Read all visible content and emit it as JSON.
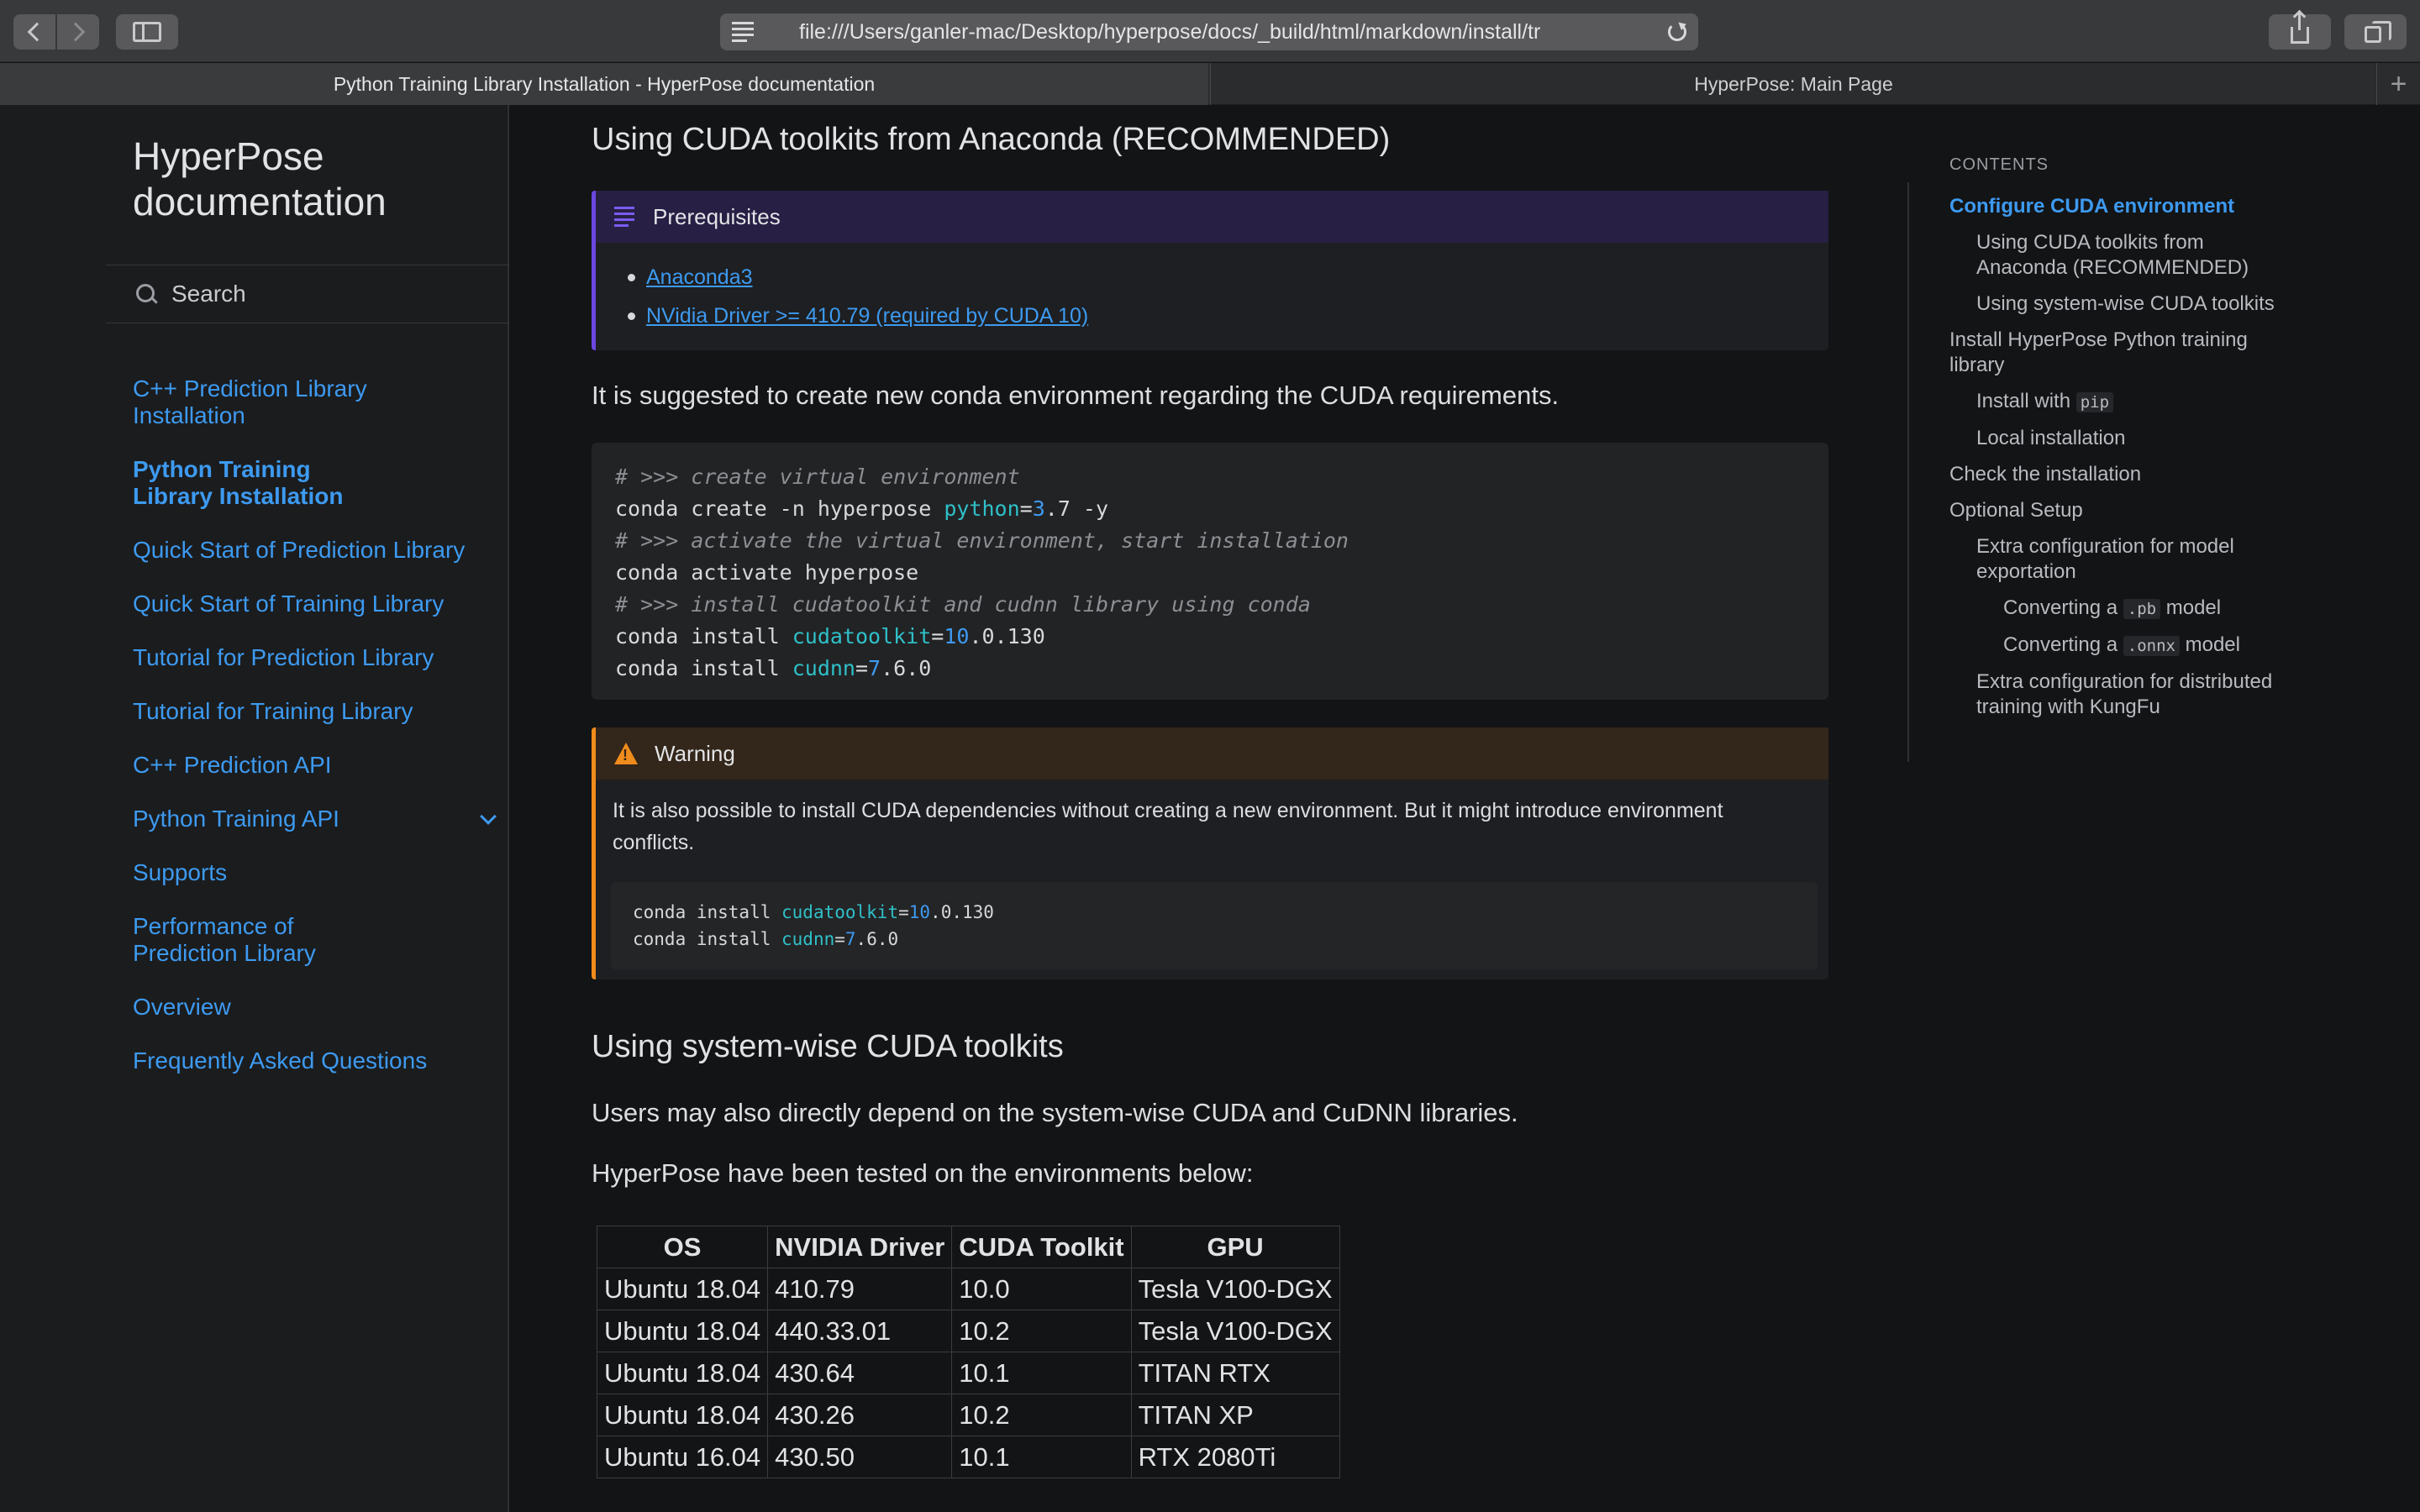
{
  "browser": {
    "url": "file:///Users/ganler-mac/Desktop/hyperpose/docs/_build/html/markdown/install/tr",
    "tabs": [
      {
        "title": "Python Training Library Installation - HyperPose documentation"
      },
      {
        "title": "HyperPose: Main Page"
      }
    ],
    "new_tab": "+"
  },
  "sidebar": {
    "brand": "HyperPose documentation",
    "search_placeholder": "Search",
    "nav": [
      {
        "label": "C++ Prediction Library Installation"
      },
      {
        "label": "Python Training Library Installation"
      },
      {
        "label": "Quick Start of Prediction Library"
      },
      {
        "label": "Quick Start of Training Library"
      },
      {
        "label": "Tutorial for Prediction Library"
      },
      {
        "label": "Tutorial for Training Library"
      },
      {
        "label": "C++ Prediction API"
      },
      {
        "label": "Python Training API"
      },
      {
        "label": "Supports"
      },
      {
        "label": "Performance of Prediction Library"
      },
      {
        "label": "Overview"
      },
      {
        "label": "Frequently Asked Questions"
      }
    ]
  },
  "main": {
    "heading_conda": "Using CUDA toolkits from Anaconda (RECOMMENDED)",
    "prereq": {
      "title": "Prerequisites",
      "items": [
        "Anaconda3",
        "NVidia Driver >= 410.79 (required by CUDA 10)"
      ]
    },
    "suggest_text": "It is suggested to create new conda environment regarding the CUDA requirements.",
    "code_lines": {
      "c1": "# >>> create virtual environment",
      "l2a": "conda create -n hyperpose ",
      "l2kw": "python",
      "l2eq": "=",
      "l2num": "3",
      "l2b": ".7 -y",
      "c3": "# >>> activate the virtual environment, start installation",
      "l4": "conda activate hyperpose",
      "c5": "# >>> install cudatoolkit and cudnn library using conda",
      "l6a": "conda install ",
      "l6kw": "cudatoolkit",
      "l6eq": "=",
      "l6num": "10",
      "l6b": ".0.130",
      "l7a": "conda install ",
      "l7kw": "cudnn",
      "l7eq": "=",
      "l7num": "7",
      "l7b": ".6.0"
    },
    "warning": {
      "title": "Warning",
      "text": "It is also possible to install CUDA dependencies without creating a new environment. But it might introduce environment conflicts."
    },
    "heading_system": "Using system-wise CUDA toolkits",
    "users_text": "Users may also directly depend on the system-wise CUDA and CuDNN libraries.",
    "tested_text": "HyperPose have been tested on the environments below:",
    "table": {
      "headers": [
        "OS",
        "NVIDIA Driver",
        "CUDA Toolkit",
        "GPU"
      ],
      "rows": [
        [
          "Ubuntu 18.04",
          "410.79",
          "10.0",
          "Tesla V100-DGX"
        ],
        [
          "Ubuntu 18.04",
          "440.33.01",
          "10.2",
          "Tesla V100-DGX"
        ],
        [
          "Ubuntu 18.04",
          "430.64",
          "10.1",
          "TITAN RTX"
        ],
        [
          "Ubuntu 18.04",
          "430.26",
          "10.2",
          "TITAN XP"
        ],
        [
          "Ubuntu 16.04",
          "430.50",
          "10.1",
          "RTX 2080Ti"
        ]
      ]
    }
  },
  "toc": {
    "title": "CONTENTS",
    "items": [
      {
        "label": "Configure CUDA environment"
      },
      {
        "label": "Using CUDA toolkits from Anaconda (RECOMMENDED)"
      },
      {
        "label": "Using system-wise CUDA toolkits"
      },
      {
        "label": "Install HyperPose Python training library"
      },
      {
        "label": "Install with ",
        "code": "pip"
      },
      {
        "label": "Local installation"
      },
      {
        "label": "Check the installation"
      },
      {
        "label": "Optional Setup"
      },
      {
        "label": "Extra configuration for model exportation"
      },
      {
        "label": "Converting a ",
        "code": ".pb",
        "suffix": " model"
      },
      {
        "label": "Converting a ",
        "code": ".onnx",
        "suffix": " model"
      },
      {
        "label": "Extra configuration for distributed training with KungFu"
      }
    ]
  },
  "colors": {
    "link": "#3d9af0",
    "prereq_accent": "#6c47e0",
    "warning_accent": "#f08c1c",
    "background": "#131416"
  }
}
